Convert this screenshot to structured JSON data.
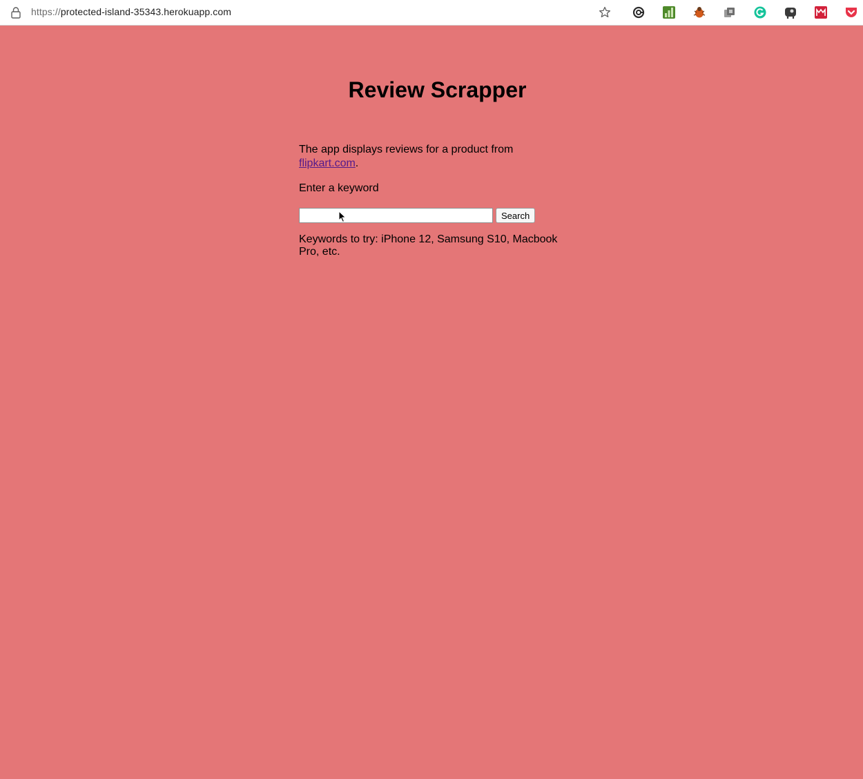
{
  "browser": {
    "url_scheme": "https://",
    "url_host": "protected-island-35343.herokuapp.com",
    "icons": [
      "lock-icon",
      "bookmark-star-icon"
    ],
    "extensions": [
      {
        "name": "link-extension-icon",
        "color": "#2b2b2b"
      },
      {
        "name": "chart-extension-icon",
        "color": "#4e8a2a"
      },
      {
        "name": "bug-extension-icon",
        "color": "#d35a1b"
      },
      {
        "name": "stack-extension-icon",
        "color": "#8a8a8a"
      },
      {
        "name": "grammarly-extension-icon",
        "color": "#15c39a"
      },
      {
        "name": "elephant-extension-icon",
        "color": "#3a3a3a"
      },
      {
        "name": "grid-extension-icon",
        "color": "#d2213a"
      },
      {
        "name": "pocket-extension-icon",
        "color": "#e8344a"
      }
    ]
  },
  "page": {
    "title": "Review Scrapper",
    "description_prefix": "The app displays reviews for a product from ",
    "description_link": "flipkart.com",
    "description_suffix": ".",
    "prompt": "Enter a keyword",
    "search": {
      "value": "",
      "placeholder": ""
    },
    "search_button": "Search",
    "hint": "Keywords to try: iPhone 12, Samsung S10, Macbook Pro, etc."
  },
  "colors": {
    "background": "#e47677",
    "link": "#551a8b"
  }
}
